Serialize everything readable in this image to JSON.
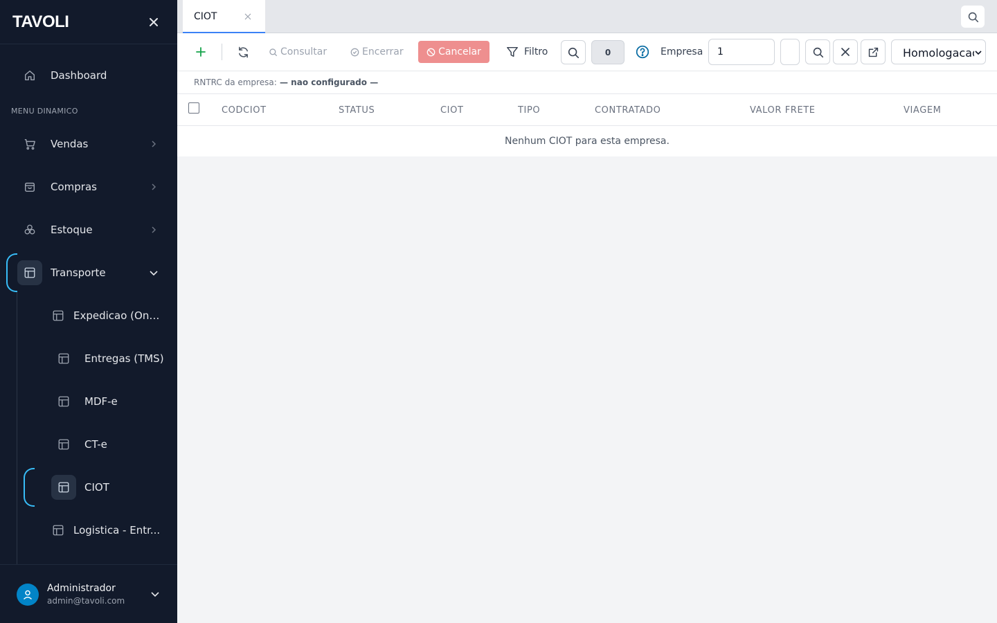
{
  "brand": {
    "name": "TAVOLI"
  },
  "sidebar": {
    "section_label": "MENU DINAMICO",
    "items": [
      {
        "label": "Dashboard",
        "icon": "home-icon"
      },
      {
        "label": "Vendas",
        "icon": "cart-icon"
      },
      {
        "label": "Compras",
        "icon": "bag-icon"
      },
      {
        "label": "Estoque",
        "icon": "boxes-icon"
      },
      {
        "label": "Transporte",
        "icon": "layout-icon",
        "expanded": true
      }
    ],
    "sub_items": [
      {
        "label": "Expedicao (Ondas)",
        "display": "Expedicao (Ond..."
      },
      {
        "label": "Entregas (TMS)"
      },
      {
        "label": "MDF-e"
      },
      {
        "label": "CT-e"
      },
      {
        "label": "CIOT",
        "active": true
      },
      {
        "label": "Logistica - Entregas",
        "display": "Logistica - Entr..."
      }
    ]
  },
  "user": {
    "name": "Administrador",
    "email": "admin@tavoli.com"
  },
  "tabs": [
    {
      "label": "CIOT",
      "active": true
    }
  ],
  "toolbar": {
    "consultar_label": "Consultar",
    "encerrar_label": "Encerrar",
    "cancelar_label": "Cancelar",
    "filtro_label": "Filtro",
    "count": "0",
    "empresa_label": "Empresa",
    "empresa_value": "1",
    "environment": "Homologacao"
  },
  "rntrc": {
    "label": "RNTRC da empresa:",
    "value": "— nao configurado —"
  },
  "table": {
    "columns": [
      "CODCIOT",
      "STATUS",
      "CIOT",
      "TIPO",
      "CONTRATADO",
      "VALOR FRETE",
      "VIAGEM"
    ],
    "empty_message": "Nenhum CIOT para esta empresa."
  },
  "colors": {
    "sidebar_bg": "#121a2b",
    "accent": "#38bdf8",
    "tab_underline": "#3b82f6",
    "cancel_bg": "#ee8f8f",
    "add_green": "#16a34a",
    "help_blue": "#0369a1",
    "avatar_bg": "#0284c7"
  }
}
